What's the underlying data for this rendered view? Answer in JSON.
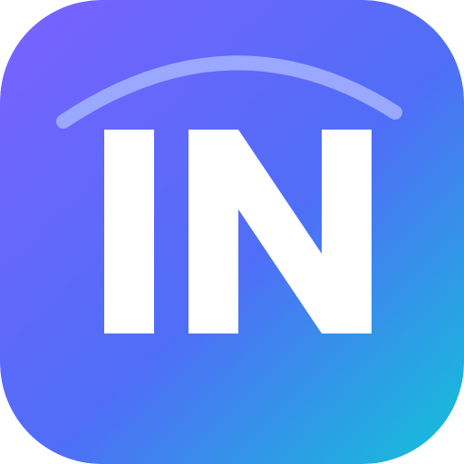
{
  "icon": {
    "name": "in-app-icon",
    "letters": "IN",
    "colors": {
      "gradient_start": "#7B61FF",
      "gradient_mid": "#4F6EF7",
      "gradient_end": "#12C2D8",
      "letters": "#FFFFFF",
      "arc": "#9AA8FF"
    }
  }
}
